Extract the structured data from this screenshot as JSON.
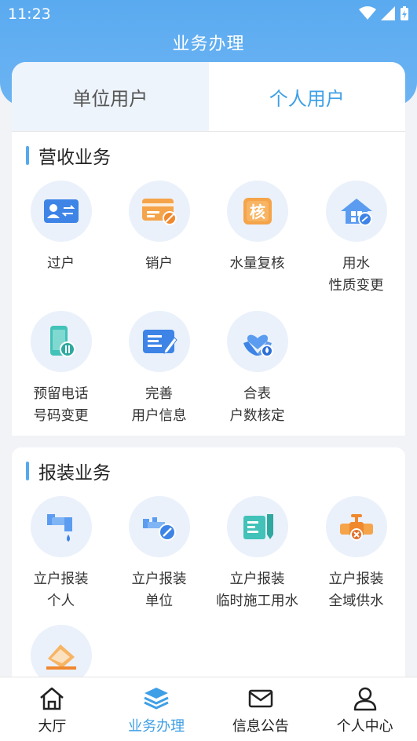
{
  "status": {
    "time": "11:23"
  },
  "page": {
    "title": "业务办理"
  },
  "tabs": [
    {
      "label": "单位用户"
    },
    {
      "label": "个人用户"
    }
  ],
  "sections": [
    {
      "title": "营收业务",
      "items": [
        {
          "label": "过户",
          "icon": "id-card-transfer-icon"
        },
        {
          "label": "销户",
          "icon": "card-cancel-icon"
        },
        {
          "label": "水量复核",
          "icon": "verify-stamp-icon"
        },
        {
          "label": "用水\n性质变更",
          "icon": "house-water-icon"
        },
        {
          "label": "预留电话\n号码变更",
          "icon": "phone-change-icon"
        },
        {
          "label": "完善\n用户信息",
          "icon": "edit-info-icon"
        },
        {
          "label": "合表\n户数核定",
          "icon": "hand-heart-water-icon"
        }
      ]
    },
    {
      "title": "报装业务",
      "items": [
        {
          "label": "立户报装\n个人",
          "icon": "faucet-drip-icon"
        },
        {
          "label": "立户报装\n单位",
          "icon": "pipe-edit-icon"
        },
        {
          "label": "立户报装\n临时施工用水",
          "icon": "meter-document-icon"
        },
        {
          "label": "立户报装\n全域供水",
          "icon": "valve-cross-icon"
        },
        {
          "label": "",
          "icon": "envelope-tray-icon"
        }
      ]
    }
  ],
  "nav": [
    {
      "label": "大厅",
      "icon": "home-icon"
    },
    {
      "label": "业务办理",
      "icon": "layers-icon"
    },
    {
      "label": "信息公告",
      "icon": "mail-icon"
    },
    {
      "label": "个人中心",
      "icon": "user-icon"
    }
  ],
  "colors": {
    "accent": "#3f9fe6",
    "header": "#62b0f2",
    "icon_orange": "#f59a3c",
    "icon_blue": "#3d84e6",
    "icon_teal": "#42c2b8"
  }
}
